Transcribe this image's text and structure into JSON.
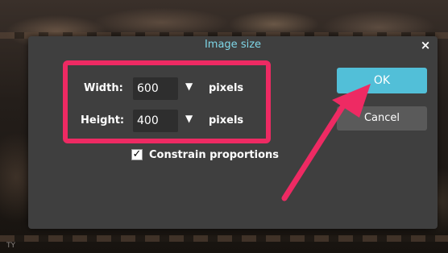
{
  "dialog": {
    "title": "Image size",
    "close_glyph": "×",
    "width_label": "Width:",
    "width_value": "600",
    "height_label": "Height:",
    "height_value": "400",
    "unit_width": "pixels",
    "unit_height": "pixels",
    "dropdown_glyph": "▼",
    "constrain_label": "Constrain proportions",
    "constrain_checked": true,
    "constrain_glyph": "✓",
    "ok_label": "OK",
    "cancel_label": "Cancel"
  },
  "icons": [
    "close-icon",
    "chevron-down-icon",
    "checkmark-icon",
    "arrow-annotation"
  ],
  "colors": {
    "accent": "#52bfd8",
    "title": "#7fd7e8",
    "highlight": "#ee2a63",
    "dialog_bg": "#3f3f3f"
  },
  "footer": {
    "corner_text": "TY"
  }
}
